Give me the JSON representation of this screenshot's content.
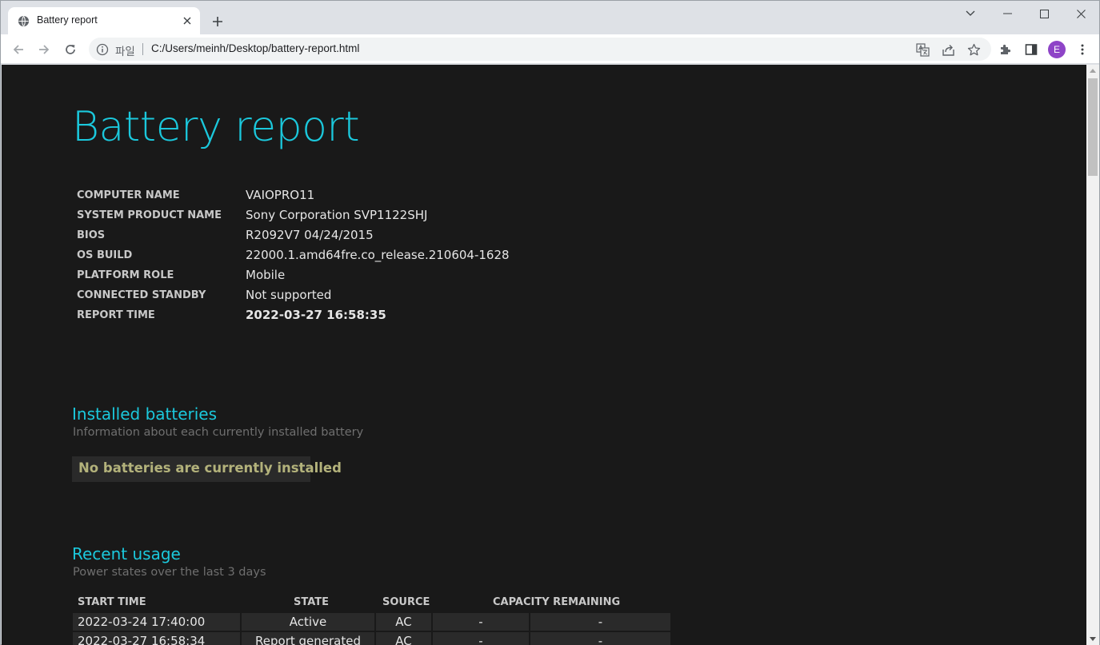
{
  "browser": {
    "tab_title": "Battery report",
    "scheme_label": "파일",
    "url": "C:/Users/meinh/Desktop/battery-report.html",
    "profile_initial": "E",
    "accent_color": "#8e44c7"
  },
  "report": {
    "title": "Battery report",
    "title_color": "#1bc8dc",
    "system_info": [
      {
        "label": "COMPUTER NAME",
        "value": "VAIOPRO11"
      },
      {
        "label": "SYSTEM PRODUCT NAME",
        "value": "Sony Corporation SVP1122SHJ"
      },
      {
        "label": "BIOS",
        "value": "R2092V7 04/24/2015"
      },
      {
        "label": "OS BUILD",
        "value": "22000.1.amd64fre.co_release.210604-1628"
      },
      {
        "label": "PLATFORM ROLE",
        "value": "Mobile"
      },
      {
        "label": "CONNECTED STANDBY",
        "value": "Not supported"
      },
      {
        "label": "REPORT TIME",
        "value": "2022-03-27  16:58:35"
      }
    ],
    "installed_batteries": {
      "heading": "Installed batteries",
      "subheading": "Information about each currently installed battery",
      "notice": "No batteries are currently installed"
    },
    "recent_usage": {
      "heading": "Recent usage",
      "subheading": "Power states over the last 3 days",
      "columns": [
        "START TIME",
        "STATE",
        "SOURCE",
        "CAPACITY REMAINING"
      ],
      "rows": [
        {
          "start_time": "2022-03-24  17:40:00",
          "state": "Active",
          "source": "AC",
          "capacity_pct": "-",
          "capacity_mwh": "-"
        },
        {
          "start_time": "2022-03-27  16:58:34",
          "state": "Report generated",
          "source": "AC",
          "capacity_pct": "-",
          "capacity_mwh": "-"
        }
      ]
    }
  }
}
